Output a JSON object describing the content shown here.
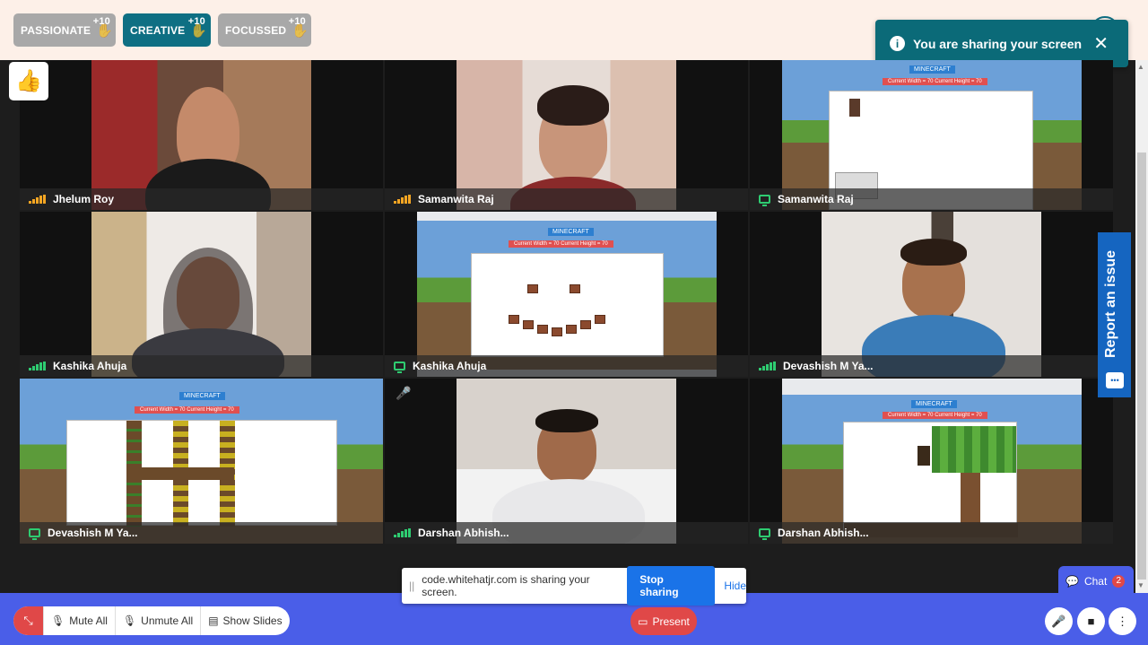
{
  "badges": [
    {
      "label": "PASSIONATE",
      "points": "+10"
    },
    {
      "label": "CREATIVE",
      "points": "+10"
    },
    {
      "label": "FOCUSSED",
      "points": "+10"
    }
  ],
  "toast": {
    "message": "You are sharing your screen",
    "close": "✕",
    "info": "i"
  },
  "reaction": "👍",
  "tiles": [
    {
      "name": "Jhelum Roy",
      "indicator": "audio"
    },
    {
      "name": "Samanwita Raj",
      "indicator": "audio"
    },
    {
      "name": "Samanwita Raj",
      "indicator": "screen"
    },
    {
      "name": "Kashika Ahuja",
      "indicator": "audio-green"
    },
    {
      "name": "Kashika Ahuja",
      "indicator": "screen"
    },
    {
      "name": "Devashish M Ya...",
      "indicator": "audio-green"
    },
    {
      "name": "Devashish M Ya...",
      "indicator": "screen"
    },
    {
      "name": "Darshan Abhish...",
      "indicator": "audio-green"
    },
    {
      "name": "Darshan Abhish...",
      "indicator": "screen"
    }
  ],
  "minecraft": {
    "title": "MINECRAFT",
    "size_label": "Current Width = 70 Current Height = 70"
  },
  "sharebar": {
    "message": "code.whitehatjr.com is sharing your screen.",
    "stop": "Stop sharing",
    "hide": "Hide"
  },
  "controls": {
    "mute_all": "Mute All",
    "unmute_all": "Unmute All",
    "show_slides": "Show Slides",
    "present": "Present"
  },
  "chat": {
    "label": "Chat",
    "count": "2"
  },
  "report": {
    "label": "Report an issue"
  },
  "colors": {
    "teal": "#0b6a78",
    "blue_bar": "#4a5ee8",
    "red": "#e04848",
    "signal_orange": "#f5a623",
    "signal_green": "#2ecc71"
  }
}
